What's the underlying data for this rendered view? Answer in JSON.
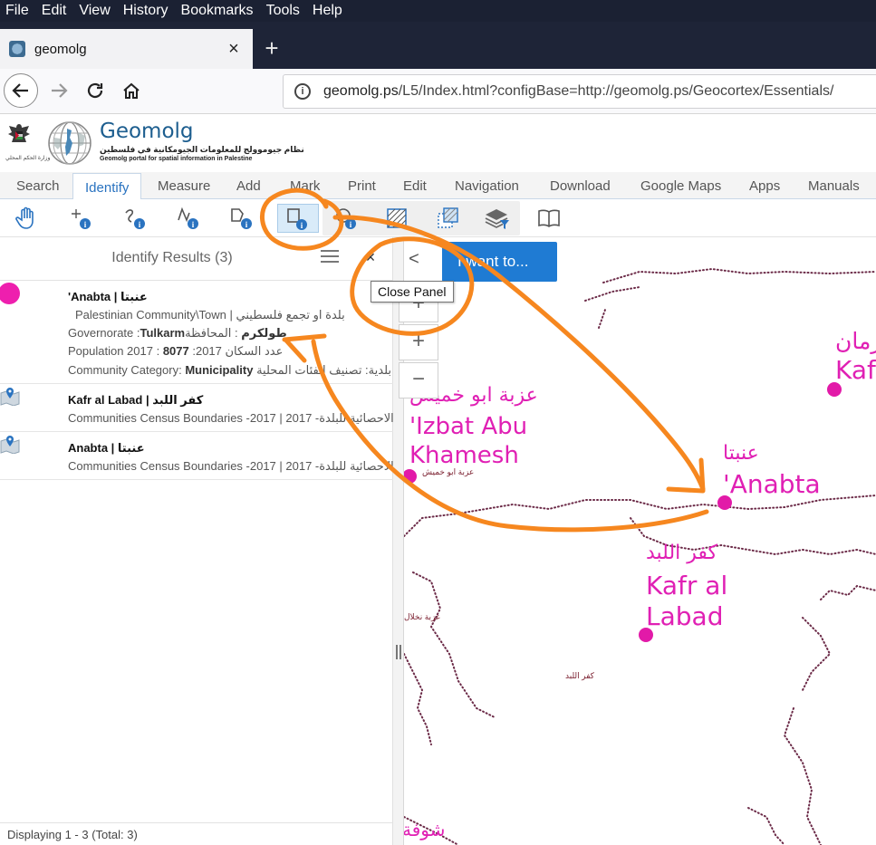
{
  "menubar": [
    "File",
    "Edit",
    "View",
    "History",
    "Bookmarks",
    "Tools",
    "Help"
  ],
  "browser": {
    "tab_title": "geomolg",
    "tab_close": "×",
    "new_tab": "+",
    "url_host": "geomolg.ps",
    "url_rest": "/L5/Index.html?configBase=http://geomolg.ps/Geocortex/Essentials/"
  },
  "app": {
    "emblem_caption": "وزارة الحكم المحلي",
    "brand_name": "Geomolg",
    "brand_ar": "نظام جيوموولج للمعلومات الجيومكانية في فلسطين",
    "brand_en": "Geomolg portal for spatial information in Palestine"
  },
  "ribbon_tabs": [
    "Search",
    "Identify",
    "Measure",
    "Add",
    "Mark",
    "Print",
    "Edit",
    "Navigation",
    "Download",
    "Google Maps",
    "Apps",
    "Manuals"
  ],
  "tools": [
    "hand-icon",
    "point-identify-icon",
    "polyline-identify-icon",
    "line-identify-icon",
    "polygon-identify-icon",
    "rectangle-identify-icon",
    "circle-identify-icon",
    "hatched-square-icon",
    "hatched-overlap-icon",
    "layers-filter-icon",
    "book-icon"
  ],
  "panel": {
    "title": "Identify Results (3)",
    "close": "×",
    "close_tooltip": "Close Panel",
    "footer": "Displaying 1 - 3 (Total: 3)",
    "results": [
      {
        "title": "'Anabta | عنبتا",
        "lines": [
          {
            "text": "Palestinian Community\\Town   |   بلدة او تجمع فلسطيني"
          },
          {
            "pre": "Governorate :",
            "bold": "Tulkarm",
            "bold_ar": "طولكرم",
            "post": ": المحافظة"
          },
          {
            "pre": "Population 2017 : ",
            "bold": "8077",
            "post": " :عدد السكان 2017"
          },
          {
            "pre": "Community Category: ",
            "bold": "Municipality",
            "post": "  بلدية: تصنيف الفئات المحلية"
          }
        ]
      },
      {
        "title": "Kafr al Labad | كفر اللبد",
        "sub": "Communities Census Boundaries -2017 | 2017 -الاحصائية للبلدة"
      },
      {
        "title": "Anabta | عنبتا",
        "sub": "Communities Census Boundaries -2017 | 2017 -الاحصائية للبلدة"
      }
    ]
  },
  "map": {
    "iwant_label": "I want to...",
    "collapse": "<",
    "zoom_in": "+",
    "zoom_out": "−",
    "places": [
      {
        "ar": "رمان",
        "en": "Kaf"
      },
      {
        "ar": "عزبة ابو خميش",
        "en1": "'Izbat Abu",
        "en2": "Khamesh"
      },
      {
        "ar": "عنبتا",
        "en": "'Anabta"
      },
      {
        "ar": "كفر اللبد",
        "en1": "Kafr al",
        "en2": "Labad"
      },
      {
        "ar": "شوفة"
      }
    ],
    "small_labels": [
      "عزبة ابو خميش",
      "عزبة نخلال",
      "كفر اللبد"
    ]
  },
  "colors": {
    "accent": "#2a73c0",
    "place": "#e020b4",
    "annotation": "#f6871f"
  }
}
